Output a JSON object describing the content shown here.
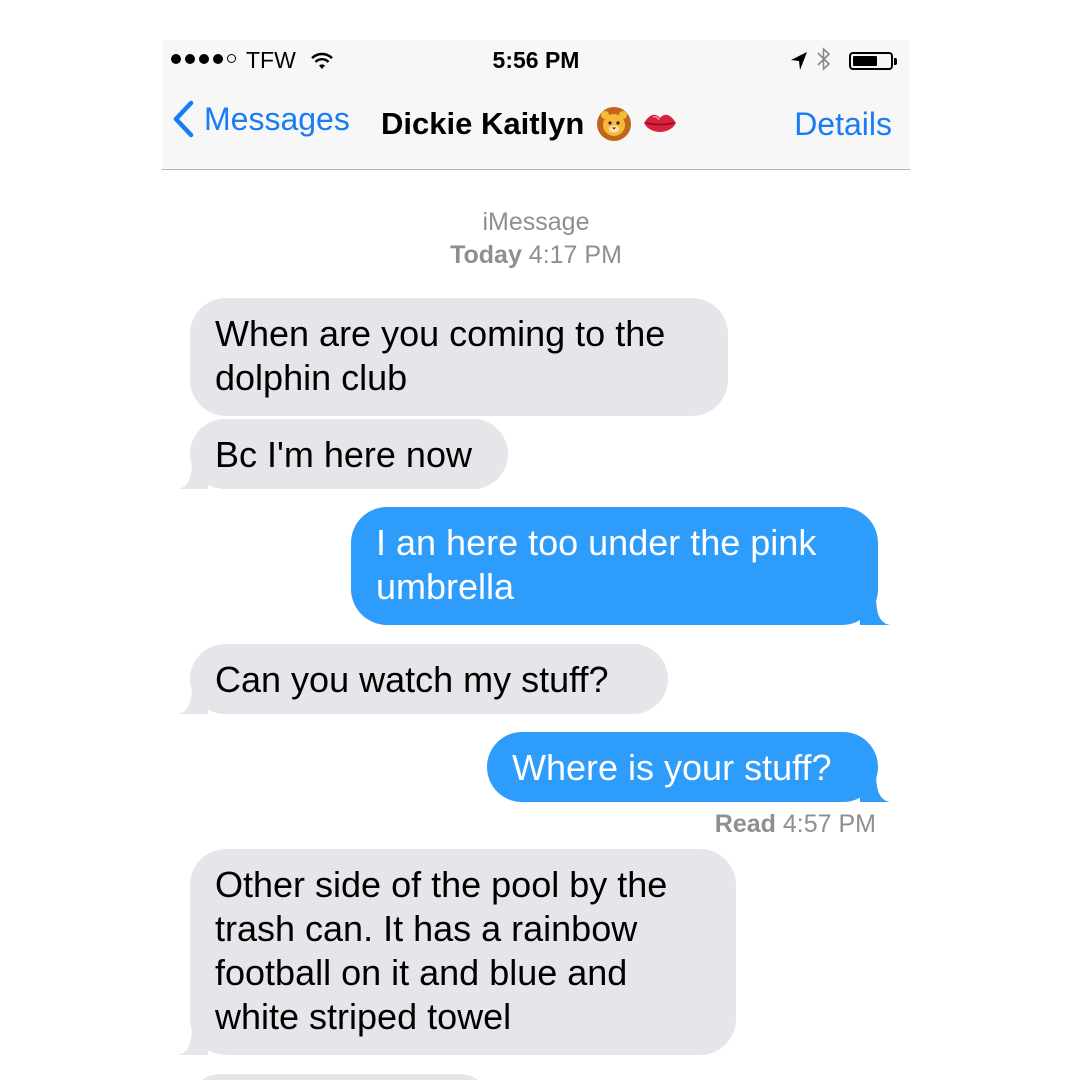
{
  "status_bar": {
    "carrier": "TFW",
    "time": "5:56 PM",
    "signal_bars_filled": 4,
    "signal_bars_total": 5
  },
  "nav": {
    "back_label": "Messages",
    "contact_name": "Dickie Kaitlyn",
    "contact_emojis": [
      "lion-face",
      "kiss-mark"
    ],
    "details_label": "Details"
  },
  "thread": {
    "service": "iMessage",
    "date_bold": "Today",
    "date_time": "4:17 PM"
  },
  "messages": [
    {
      "direction": "incoming",
      "text": "When are you coming to the dolphin club"
    },
    {
      "direction": "incoming",
      "text": "Bc I'm here now"
    },
    {
      "direction": "outgoing",
      "text": "I an here too under the pink umbrella"
    },
    {
      "direction": "incoming",
      "text": "Can you watch my stuff?"
    },
    {
      "direction": "outgoing",
      "text": "Where is your stuff?"
    },
    {
      "direction": "incoming",
      "text": "Other side of the pool by the trash can. It has a rainbow football on it and blue and white striped towel"
    }
  ],
  "receipt": {
    "label": "Read",
    "time": "4:57 PM"
  },
  "colors": {
    "ios_blue": "#1a7cf4",
    "outgoing_bubble": "#2e9cfb",
    "incoming_bubble": "#e5e5ea",
    "meta_gray": "#8e8e93"
  }
}
